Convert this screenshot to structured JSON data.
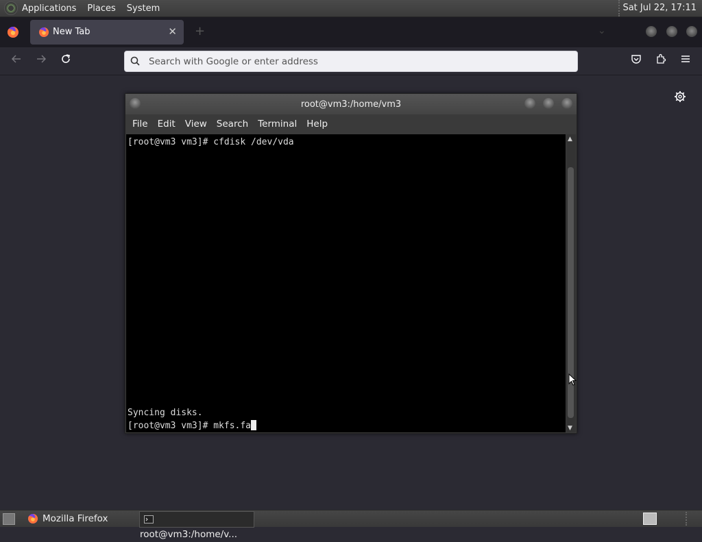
{
  "top_panel": {
    "menus": [
      "Applications",
      "Places",
      "System"
    ],
    "clock": "Sat Jul 22, 17:11"
  },
  "browser": {
    "tab": {
      "title": "New Tab",
      "close": "✕"
    },
    "new_tab": "+",
    "url_placeholder": "Search with Google or enter address",
    "icons": [
      "back-arrow-icon",
      "forward-arrow-icon",
      "reload-icon",
      "search-icon",
      "pocket-icon",
      "extensions-icon",
      "hamburger-menu-icon",
      "gear-icon"
    ]
  },
  "terminal": {
    "title": "root@vm3:/home/vm3",
    "menu": [
      "File",
      "Edit",
      "View",
      "Search",
      "Terminal",
      "Help"
    ],
    "lines": {
      "line1": "[root@vm3 vm3]# cfdisk /dev/vda",
      "line2": "Syncing disks.",
      "line3": "[root@vm3 vm3]# mkfs.fa"
    }
  },
  "taskbar": {
    "tasks": [
      "Mozilla Firefox",
      "root@vm3:/home/v..."
    ]
  },
  "colors": {
    "browser_bg": "#2b2a33",
    "tabstrip_bg": "#1c1b22",
    "terminal_bg": "#000000",
    "urlbar_bg": "#f0f0f4"
  }
}
